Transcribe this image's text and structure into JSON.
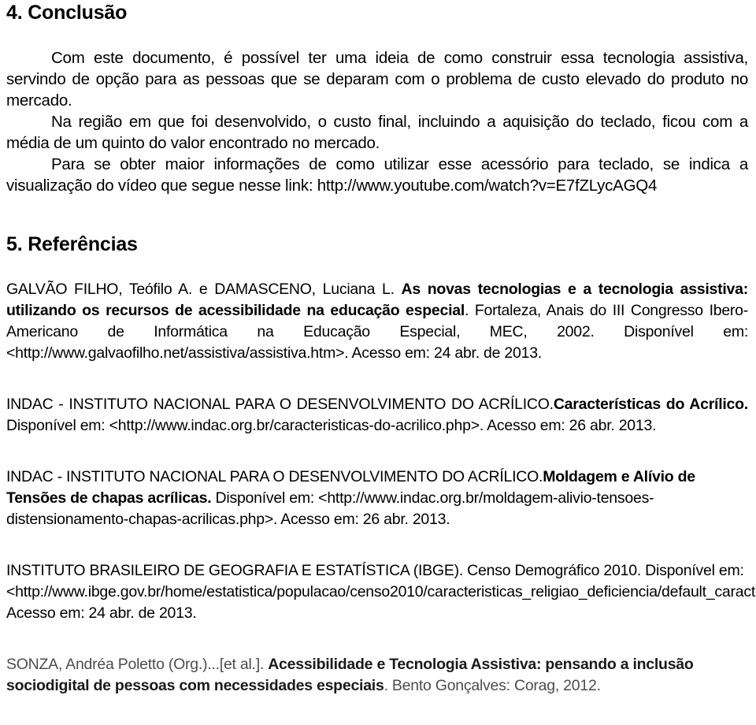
{
  "document": {
    "sections": [
      {
        "id": "conclusao",
        "heading": "4. Conclusão",
        "paragraphs": [
          "Com este documento, é possível ter uma ideia de como construir essa tecnologia assistiva, servindo de opção para as pessoas que se deparam com o problema de custo elevado do produto no mercado.",
          "Na região em que foi desenvolvido, o custo final, incluindo a aquisição do teclado, ficou com a média de um quinto do valor encontrado no mercado.",
          "Para se obter maior informações de como utilizar esse acessório para teclado, se indica a visualização do vídeo que segue nesse link: http://www.youtube.com/watch?v=E7fZLycAGQ4"
        ]
      },
      {
        "id": "referencias",
        "heading": "5. Referências",
        "entries": [
          {
            "id": "galvao-filho",
            "pre_title": "GALVÃO FILHO, Teófilo A. e DAMASCENO, Luciana L. ",
            "title": "As novas tecnologias e a tecnologia assistiva: utilizando os recursos de acessibilidade na educação especial",
            "post_title": ". Fortaleza, Anais do III Congresso Ibero-Americano de Informática na Educação Especial, MEC, 2002. Disponível em: <http://www.galvaofilho.net/assistiva/assistiva.htm>. Acesso em: 24 abr. de 2013."
          },
          {
            "id": "indac-caracteristicas",
            "pre_title": "INDAC - INSTITUTO NACIONAL PARA O DESENVOLVIMENTO DO ACRÍLICO.",
            "title": "Características do Acrílico.",
            "post_title": " Disponível em: <http://www.indac.org.br/caracteristicas-do-acrilico.php>. Acesso em: 26 abr. 2013."
          },
          {
            "id": "indac-moldagem",
            "pre_title": "INDAC - INSTITUTO NACIONAL PARA O DESENVOLVIMENTO DO ACRÍLICO.",
            "title": "Moldagem e Alívio de Tensões de chapas acrílicas.",
            "post_title": " Disponível em: <http://www.indac.org.br/moldagem-alivio-tensoes-distensionamento-chapas-acrilicas.php>. Acesso em: 26 abr. 2013."
          },
          {
            "id": "ibge",
            "pre_title": "INSTITUTO BRASILEIRO DE GEOGRAFIA E ESTATÍSTICA (IBGE). Censo Demográfico 2010. Disponível em:<http://www.ibge.gov.br/home/estatistica/populacao/censo2010/caracteristicas_religiao_deficiencia/default_caracteristicas_religiao_deficiencia.shtm>. Acesso em: 24 abr. de 2013.",
            "title": "",
            "post_title": ""
          },
          {
            "id": "sonza",
            "pre_title": "SONZA, Andréa Poletto (Org.)...[et al.]. ",
            "title": "Acessibilidade e Tecnologia Assistiva: pensando a inclusão sociodigital de pessoas com necessidades especiais",
            "post_title": ". Bento Gonçalves: Corag, 2012."
          }
        ]
      }
    ]
  }
}
